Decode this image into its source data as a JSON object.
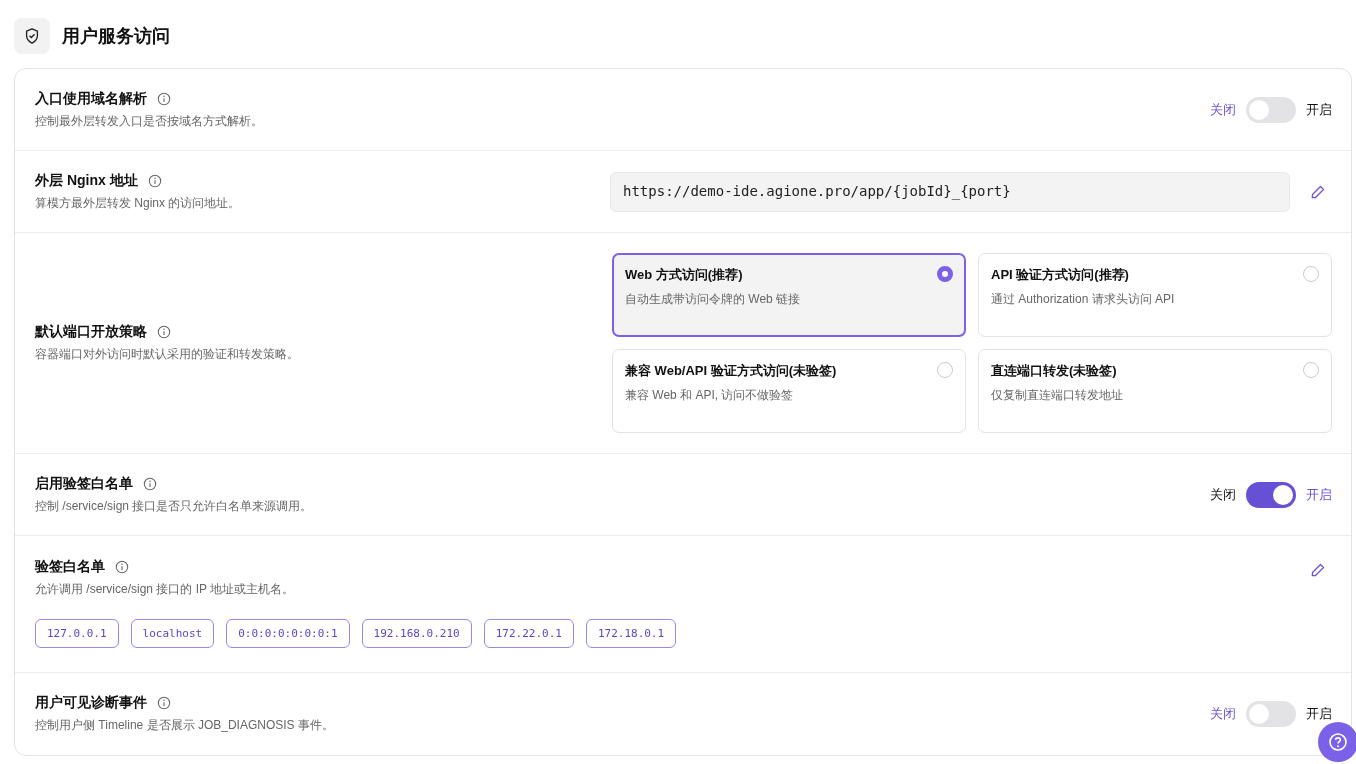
{
  "header": {
    "title": "用户服务访问"
  },
  "rows": [
    {
      "kind": "toggle",
      "label": "入口使用域名解析",
      "description": "控制最外层转发入口是否按域名方式解析。",
      "off_label": "关闭",
      "on_label": "开启",
      "on": false
    },
    {
      "kind": "field",
      "label": "外层 Nginx 地址",
      "description": "算模方最外层转发 Nginx 的访问地址。",
      "value": "https://demo-ide.agione.pro/app/{jobId}_{port}"
    },
    {
      "kind": "options",
      "label": "默认端口开放策略",
      "description": "容器端口对外访问时默认采用的验证和转发策略。",
      "options": [
        {
          "title": "Web 方式访问(推荐)",
          "description": "自动生成带访问令牌的 Web 链接",
          "selected": true
        },
        {
          "title": "API 验证方式访问(推荐)",
          "description": "通过 Authorization 请求头访问 API",
          "selected": false
        },
        {
          "title": "兼容 Web/API 验证方式访问(未验签)",
          "description": "兼容 Web 和 API, 访问不做验签",
          "selected": false
        },
        {
          "title": "直连端口转发(未验签)",
          "description": "仅复制直连端口转发地址",
          "selected": false
        }
      ]
    },
    {
      "kind": "toggle",
      "label": "启用验签白名单",
      "description": "控制 /service/sign 接口是否只允许白名单来源调用。",
      "off_label": "关闭",
      "on_label": "开启",
      "on": true
    },
    {
      "kind": "tags",
      "label": "验签白名单",
      "description": "允许调用 /service/sign 接口的 IP 地址或主机名。",
      "tags": [
        "127.0.0.1",
        "localhost",
        "0:0:0:0:0:0:0:1",
        "192.168.0.210",
        "172.22.0.1",
        "172.18.0.1"
      ]
    },
    {
      "kind": "toggle",
      "label": "用户可见诊断事件",
      "description": "控制用户侧 Timeline 是否展示 JOB_DIAGNOSIS 事件。",
      "off_label": "关闭",
      "on_label": "开启",
      "on": false
    }
  ]
}
